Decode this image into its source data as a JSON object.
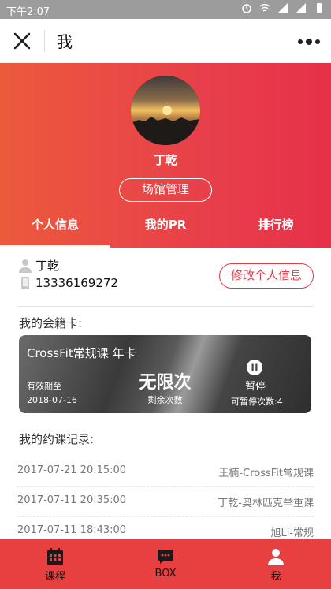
{
  "statusbar": {
    "time": "下午2:07"
  },
  "navbar": {
    "title": "我"
  },
  "profile": {
    "name": "丁乾",
    "venue_button": "场馆管理"
  },
  "tabs": [
    {
      "label": "个人信息",
      "active": true
    },
    {
      "label": "我的PR",
      "active": false
    },
    {
      "label": "排行榜",
      "active": false
    }
  ],
  "info": {
    "name": "丁乾",
    "phone": "13336169272",
    "edit_button": "修改个人信息"
  },
  "membership": {
    "section_title": "我的会籍卡:",
    "card_title": "CrossFit常规课 年卡",
    "valid_label": "有效期至",
    "valid_date": "2018-07-16",
    "count": "无限次",
    "count_label": "剩余次数",
    "pause_label": "暂停",
    "pause_count": "可暂停次数:4"
  },
  "records": {
    "section_title": "我的约课记录:",
    "items": [
      {
        "date": "2017-07-21 20:15:00",
        "course": "王楠-CrossFit常规课"
      },
      {
        "date": "2017-07-11 20:35:00",
        "course": "丁乾-奥林匹克举重课"
      },
      {
        "date": "2017-07-11 18:43:00",
        "course": "旭Li-常规"
      }
    ]
  },
  "bottom_nav": [
    {
      "label": "课程",
      "icon": "calendar-icon"
    },
    {
      "label": "BOX",
      "icon": "chat-icon"
    },
    {
      "label": "我",
      "icon": "person-icon"
    }
  ],
  "colors": {
    "accent": "#e84040",
    "hero_start": "#ec5a3c",
    "hero_end": "#e63149"
  }
}
